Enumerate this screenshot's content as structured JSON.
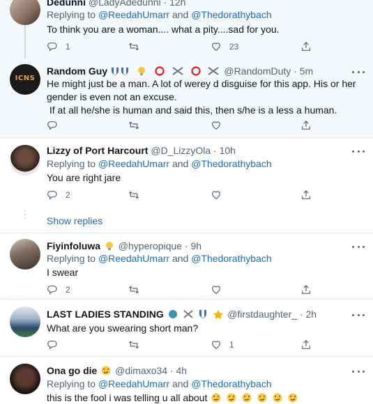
{
  "colors": {
    "link": "#1b6cb0",
    "muted": "#536471",
    "text": "#0f1419",
    "shaded_bg": "#f5f8fa"
  },
  "icons": {
    "reply": "reply-icon",
    "retweet": "retweet-icon",
    "like": "heart-icon",
    "share": "share-icon",
    "more": "more-icon"
  },
  "tweets": [
    {
      "name": "Dedunni",
      "handle": "@LadyAdedunni",
      "time": "12h",
      "reply_prefix": "Replying to",
      "reply_to_1": "@ReedahUmarr",
      "reply_and": "and",
      "reply_to_2": "@Thedorathybach",
      "text": "To think you are a woman.... what a pity....sad for you.",
      "replies": "1",
      "retweets": "",
      "likes": "23"
    },
    {
      "name": "Random Guy",
      "handle": "@RandomDuty",
      "dot": "·",
      "time": "5m",
      "avatar_text": "ICNS",
      "text_lines": [
        "He might just be a man. A lot of werey d disguise for this app. His or her",
        "gender is even not an excuse.",
        " If at all he/she is human and said this, then s/he is a less a human."
      ],
      "replies": "",
      "retweets": "",
      "likes": ""
    },
    {
      "name": "Lizzy of Port Harcourt",
      "handle": "@D_LizzyOla",
      "dot": "·",
      "time": "10h",
      "reply_prefix": "Replying to",
      "reply_to_1": "@ReedahUmarr",
      "reply_and": "and",
      "reply_to_2": "@Thedorathybach",
      "text": "You are right jare",
      "replies": "2",
      "retweets": "",
      "likes": "",
      "show_replies": "Show replies"
    },
    {
      "name": "Fiyinfoluwa",
      "handle": "@hyperopique",
      "dot": "·",
      "time": "9h",
      "reply_prefix": "Replying to",
      "reply_to_1": "@ReedahUmarr",
      "reply_and": "and",
      "reply_to_2": "@Thedorathybach",
      "text": "I swear",
      "replies": "2",
      "retweets": "",
      "likes": ""
    },
    {
      "name": "LAST LADIES STANDING",
      "handle": "@firstdaughter_",
      "dot": "·",
      "time": "2h",
      "text": "What are you swearing short man?",
      "replies": "",
      "retweets": "",
      "likes": "1"
    },
    {
      "name": "Ona go die",
      "handle": "@dimaxo34",
      "dot": "·",
      "time": "4h",
      "reply_prefix": "Replying to",
      "reply_to_1": "@ReedahUmarr",
      "reply_and": "and",
      "reply_to_2": "@Thedorathybach",
      "text": "this is the fool i was telling u all about"
    }
  ]
}
